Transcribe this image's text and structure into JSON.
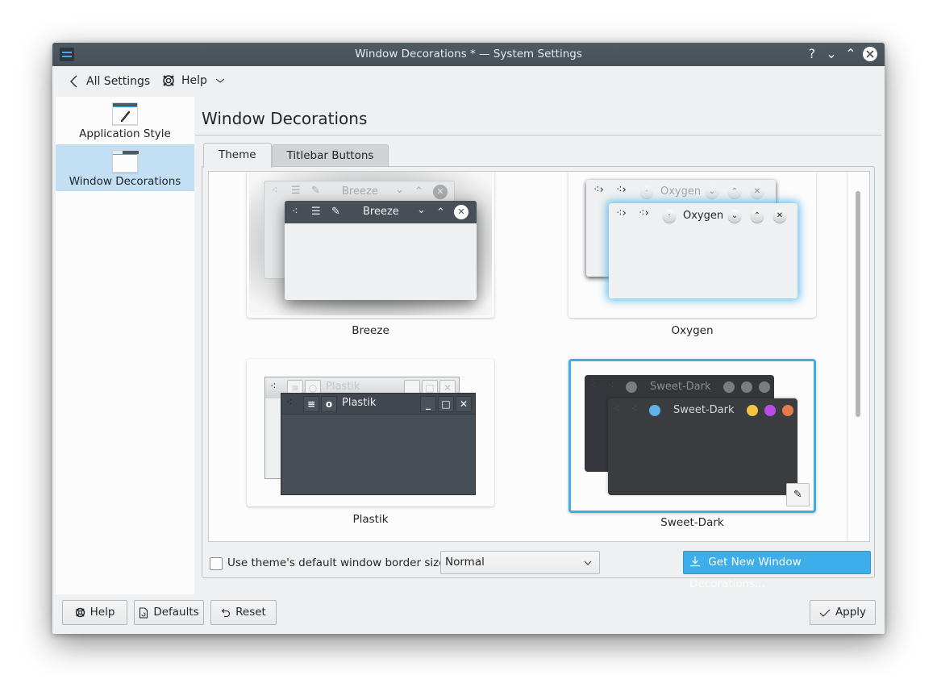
{
  "window": {
    "title": "Window Decorations * — System Settings",
    "titlebar_buttons": {
      "help": "?",
      "minimize": "⌄",
      "maximize": "⌃",
      "close": "✕"
    }
  },
  "toolbar": {
    "back_icon": "‹",
    "all_settings": "All Settings",
    "help": "Help",
    "help_chevron": "⌄"
  },
  "sidebar": {
    "items": [
      {
        "label": "Application Style",
        "icon": "brush-icon",
        "active": false
      },
      {
        "label": "Window Decorations",
        "icon": "window-icon",
        "active": true
      }
    ]
  },
  "main": {
    "title": "Window Decorations",
    "tabs": [
      {
        "label": "Theme",
        "active": true
      },
      {
        "label": "Titlebar Buttons",
        "active": false
      }
    ],
    "themes": [
      {
        "name": "Breeze",
        "preview_title": "Breeze",
        "selected": false
      },
      {
        "name": "Oxygen",
        "preview_title": "Oxygen",
        "selected": false
      },
      {
        "name": "Plastik",
        "preview_title": "Plastik",
        "selected": false
      },
      {
        "name": "Sweet-Dark",
        "preview_title": "Sweet-Dark",
        "selected": true
      }
    ],
    "sweet_dark_colors": {
      "left_button": "#5fb1e8",
      "minimize": "#f3c440",
      "maximize": "#b84de8",
      "close": "#e37b4a",
      "inactive": "#7b7c80"
    },
    "use_default_border_label": "Use theme's default window border size",
    "use_default_border_checked": false,
    "border_size": "Normal",
    "get_new_label": "Get New Window Decorations..."
  },
  "footer": {
    "help": "Help",
    "defaults": "Defaults",
    "reset": "Reset",
    "apply": "Apply"
  },
  "accent_color": "#3daee9"
}
